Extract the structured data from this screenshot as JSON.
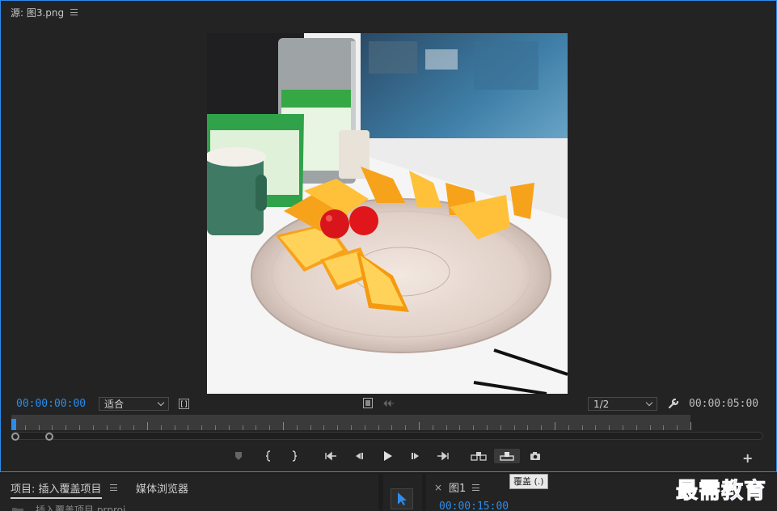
{
  "source_panel": {
    "title": "源: 图3.png"
  },
  "monitor": {
    "current_time": "00:00:00:00",
    "duration": "00:00:05:00",
    "zoom_select": "适合",
    "resolution_select": "1/2"
  },
  "tooltip": "覆盖 (.)",
  "project_panel": {
    "tab_project": "项目: 插入覆盖项目",
    "tab_media_browser": "媒体浏览器",
    "file_item": "插入覆盖项目.prproj"
  },
  "sequence_panel": {
    "tab_label": "图1",
    "close_glyph": "×",
    "timecode": "00:00:15:00"
  },
  "watermark": "最需教育",
  "colors": {
    "accent": "#2d8ceb",
    "panel_bg": "#232323",
    "watermark": "#1a3fd8"
  },
  "icons": {
    "marker": "marker-icon",
    "mark_in": "mark-in-icon",
    "mark_out": "mark-out-icon",
    "go_to_in": "go-to-in-icon",
    "step_back": "step-back-icon",
    "play": "play-icon",
    "step_forward": "step-forward-icon",
    "go_to_out": "go-to-out-icon",
    "insert": "insert-icon",
    "overwrite": "overwrite-icon",
    "export_frame": "camera-icon",
    "settings": "wrench-icon",
    "add": "plus-icon",
    "selection_tool": "arrow-icon"
  }
}
